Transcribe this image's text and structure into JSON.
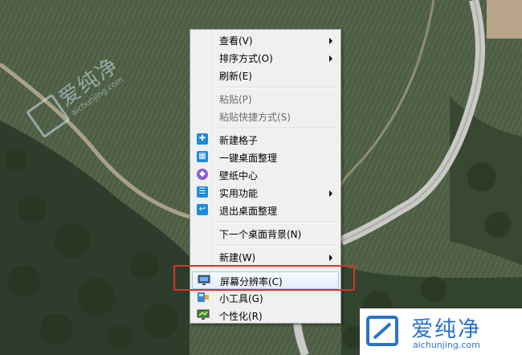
{
  "watermark": {
    "brand": "爱纯净",
    "url": "aichunjing.com"
  },
  "context_menu": {
    "items": [
      {
        "label": "查看(V)",
        "submenu": true
      },
      {
        "label": "排序方式(O)",
        "submenu": true
      },
      {
        "label": "刷新(E)"
      },
      {
        "label": "粘贴(P)",
        "disabled": true
      },
      {
        "label": "粘贴快捷方式(S)",
        "disabled": true
      },
      {
        "label": "新建格子",
        "icon": "blue-plus-icon"
      },
      {
        "label": "一键桌面整理",
        "icon": "blue-grid-icon"
      },
      {
        "label": "壁纸中心",
        "icon": "purple-cube-icon"
      },
      {
        "label": "实用功能",
        "icon": "blue-list-icon",
        "submenu": true
      },
      {
        "label": "退出桌面整理",
        "icon": "blue-exit-icon"
      },
      {
        "label": "下一个桌面背景(N)"
      },
      {
        "label": "新建(W)",
        "submenu": true
      },
      {
        "label": "屏幕分辨率(C)",
        "icon": "monitor-icon",
        "highlighted": true
      },
      {
        "label": "小工具(G)",
        "icon": "gadget-icon"
      },
      {
        "label": "个性化(R)",
        "icon": "personalize-icon"
      }
    ]
  },
  "colors": {
    "icon_blue": "#1e8bd8",
    "icon_purple": "#8a5cd6",
    "highlight_box": "#e12c2c",
    "watermark_blue": "#2a73c8"
  }
}
